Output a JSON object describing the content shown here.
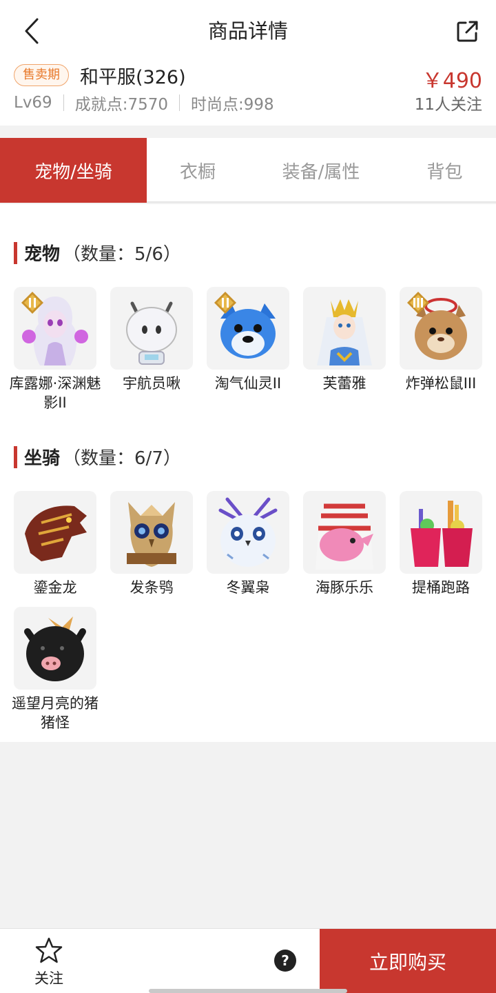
{
  "header": {
    "title": "商品详情",
    "badge": "售卖期",
    "server": "和平服(326)",
    "level": "Lv69",
    "achievement": "成就点:7570",
    "fashion": "时尚点:998",
    "price": "￥490",
    "followers": "11人关注"
  },
  "tabs": [
    {
      "label": "宠物/坐骑",
      "active": true
    },
    {
      "label": "衣橱",
      "active": false
    },
    {
      "label": "装备/属性",
      "active": false
    },
    {
      "label": "背包",
      "active": false
    }
  ],
  "pets": {
    "title": "宠物",
    "count": "（数量：5/6）",
    "items": [
      {
        "name": "库露娜·深渊魅影II",
        "rank": "II"
      },
      {
        "name": "宇航员啾",
        "rank": ""
      },
      {
        "name": "淘气仙灵II",
        "rank": "II"
      },
      {
        "name": "芙蕾雅",
        "rank": ""
      },
      {
        "name": "炸弹松鼠III",
        "rank": "III"
      }
    ]
  },
  "mounts": {
    "title": "坐骑",
    "count": "（数量：6/7）",
    "items": [
      {
        "name": "鎏金龙"
      },
      {
        "name": "发条鸮"
      },
      {
        "name": "冬翼枭"
      },
      {
        "name": "海豚乐乐"
      },
      {
        "name": "提桶跑路"
      },
      {
        "name": "遥望月亮的猪猪怪"
      }
    ]
  },
  "bottom": {
    "follow_label": "关注",
    "help_label": "?",
    "buy_label": "立即购买"
  },
  "colors": {
    "accent": "#c8372f",
    "badge": "#e87a2c"
  }
}
